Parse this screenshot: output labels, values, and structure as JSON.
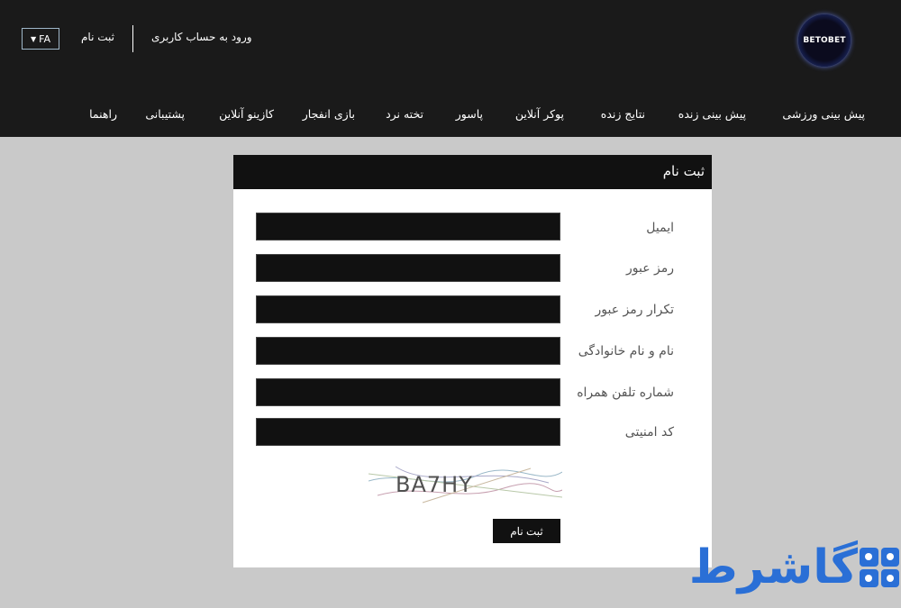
{
  "header": {
    "language": "FA",
    "register_link": "ثبت نام",
    "login_link": "ورود به حساب کاربری",
    "logo_text": "BETOBET"
  },
  "nav": {
    "items": [
      "پیش بینی ورزشی",
      "پیش بینی زنده",
      "نتایج زنده",
      "پوکر آنلاین",
      "پاسور",
      "تخته نرد",
      "بازی انفجار",
      "کازینو آنلاین",
      "پشتیبانی",
      "راهنما"
    ]
  },
  "register_form": {
    "title": "ثبت نام",
    "fields": [
      {
        "label": "ایمیل",
        "value": ""
      },
      {
        "label": "رمز عبور",
        "value": ""
      },
      {
        "label": "تکرار رمز عبور",
        "value": ""
      },
      {
        "label": "نام و نام خانوادگی",
        "value": ""
      },
      {
        "label": "شماره تلفن همراه",
        "value": ""
      },
      {
        "label": "کد امنیتی",
        "value": ""
      }
    ],
    "captcha_text": "BA7HY",
    "submit_label": "ثبت نام"
  },
  "watermark": {
    "text": "گاشرط",
    "color": "#2a6fd6"
  },
  "colors": {
    "header_bg": "#1a1a1a",
    "page_bg": "#c9c9c9",
    "input_bg": "#111111"
  }
}
